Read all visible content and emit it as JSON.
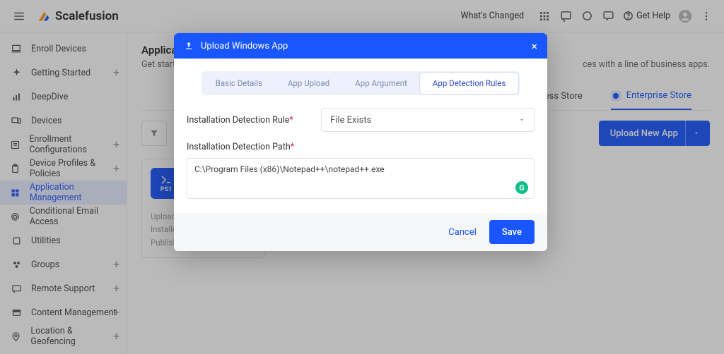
{
  "topbar": {
    "brand": "Scalefusion",
    "whats_changed": "What's Changed",
    "get_help": "Get Help"
  },
  "sidebar": {
    "items": [
      {
        "label": "Enroll Devices",
        "icon": "device-icon",
        "plus": false
      },
      {
        "label": "Getting Started",
        "icon": "sparkle-icon",
        "plus": true
      },
      {
        "label": "DeepDive",
        "icon": "bars-icon",
        "plus": false
      },
      {
        "label": "Devices",
        "icon": "devices-icon",
        "plus": false
      },
      {
        "label": "Enrollment Configurations",
        "icon": "config-icon",
        "plus": true
      },
      {
        "label": "Device Profiles & Policies",
        "icon": "clipboard-icon",
        "plus": true
      },
      {
        "label": "Application Management",
        "icon": "apps-icon",
        "plus": false
      },
      {
        "label": "Conditional Email Access",
        "icon": "at-icon",
        "plus": false
      },
      {
        "label": "Utilities",
        "icon": "utilities-icon",
        "plus": false
      },
      {
        "label": "Groups",
        "icon": "groups-icon",
        "plus": true
      },
      {
        "label": "Remote Support",
        "icon": "cast-icon",
        "plus": true
      },
      {
        "label": "Content Management",
        "icon": "content-icon",
        "plus": true
      },
      {
        "label": "Location & Geofencing",
        "icon": "location-icon",
        "plus": true
      }
    ],
    "active_index": 6
  },
  "page": {
    "title_prefix": "Applicatio",
    "subtitle_prefix": "Get startes",
    "subtitle_suffix": "ces with a line of business apps.",
    "store_tabs": {
      "business": "ness Store",
      "enterprise": "Enterprise Store"
    },
    "filter_placeholder": "Filt",
    "upload_button": "Upload New App"
  },
  "card": {
    "badge": "PS1",
    "uploaded": "Uploaded",
    "installed": "Installed o",
    "published": "Published"
  },
  "modal": {
    "title": "Upload Windows App",
    "tabs": [
      "Basic Details",
      "App Upload",
      "App Argument",
      "App Detection Rules"
    ],
    "active_tab_index": 3,
    "rule_label": "Installation Detection Rule",
    "rule_value": "File Exists",
    "path_label": "Installation Detection Path",
    "path_value": "C:\\Program Files (x86)\\Notepad++\\notepad++.exe",
    "cancel": "Cancel",
    "save": "Save"
  }
}
